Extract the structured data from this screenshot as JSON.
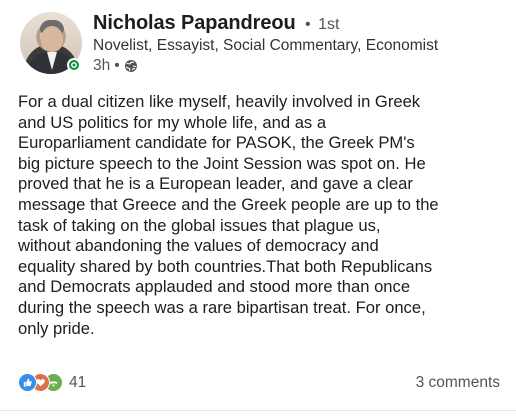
{
  "post": {
    "author": {
      "name": "Nicholas Papandreou",
      "connection_degree": "1st",
      "headline": "Novelist, Essayist, Social Commentary, Economist",
      "time_posted": "3h",
      "visibility_icon": "globe-icon",
      "online_status_color": "#0a8f3c"
    },
    "text": "For a dual citizen like myself, heavily involved in Greek\nand US politics for my whole life, and as a\nEuroparliament candidate for PASOK, the Greek PM's\nbig picture speech to the Joint Session was spot on. He\nproved that he is a European leader, and gave a clear\nmessage that Greece and the Greek people are up to the\ntask of taking on the global issues that plague us,\nwithout abandoning the values of democracy and\nequality shared by both countries.That both Republicans\nand Democrats applauded and stood more than once\nduring the speech was a rare bipartisan treat. For once,\nonly pride.",
    "reactions": {
      "icons": [
        "like-icon",
        "love-icon",
        "support-icon"
      ],
      "colors": [
        "#378fe9",
        "#df704d",
        "#6dae4f"
      ],
      "count": "41"
    },
    "comments_label": "3 comments"
  },
  "ui": {
    "separator_dot": "•"
  }
}
